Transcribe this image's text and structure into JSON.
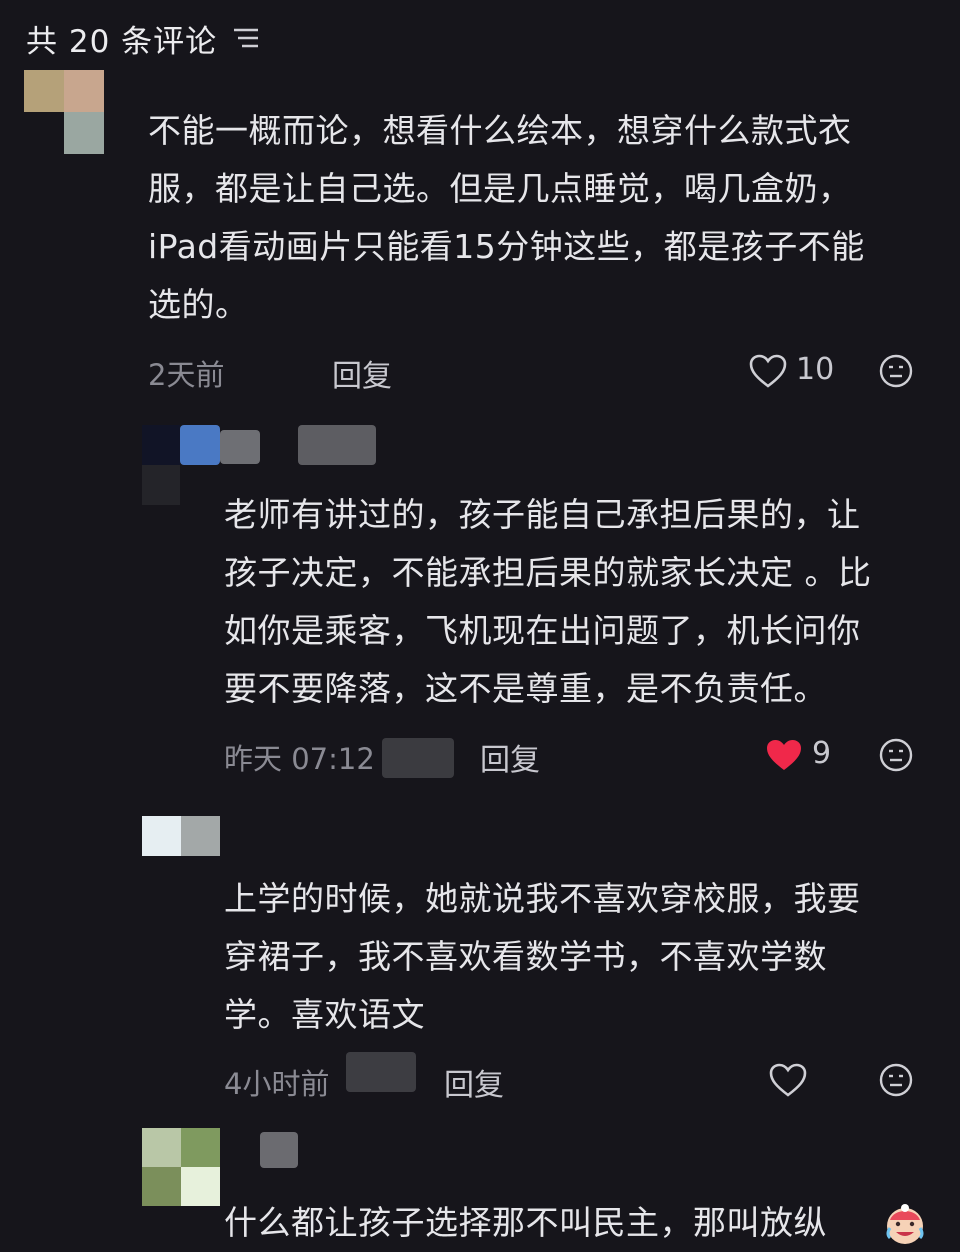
{
  "header": {
    "title": "共 20 条评论",
    "filter_icon": "filter-icon"
  },
  "comments": [
    {
      "lines": [
        "不能一概而论，想看什么绘本，想穿什么款式衣",
        "服，都是让自己选。但是几点睡觉，喝几盒奶，",
        "iPad看动画片只能看15分钟这些，都是孩子不能",
        "选的。"
      ],
      "time": "2天前",
      "reply_label": "回复",
      "likes": "10",
      "liked": false
    },
    {
      "lines": [
        "老师有讲过的，孩子能自己承担后果的，让",
        "孩子决定，不能承担后果的就家长决定 。比",
        "如你是乘客，飞机现在出问题了，机长问你",
        "要不要降落，这不是尊重，是不负责任。"
      ],
      "time": "昨天 07:12",
      "reply_label": "回复",
      "likes": "9",
      "liked": true
    },
    {
      "lines": [
        "上学的时候，她就说我不喜欢穿校服，我要",
        "穿裙子，我不喜欢看数学书，不喜欢学数",
        "学。喜欢语文"
      ],
      "time": "4小时前",
      "reply_label": "回复",
      "likes": "",
      "liked": false
    },
    {
      "lines": [
        "什么都让孩子选择那不叫民主，那叫放纵"
      ],
      "emoji": "crying-laughing-emoji"
    }
  ],
  "colors": {
    "background": "#16151b",
    "liked_heart": "#f0284a",
    "muted": "#8a8a93"
  }
}
